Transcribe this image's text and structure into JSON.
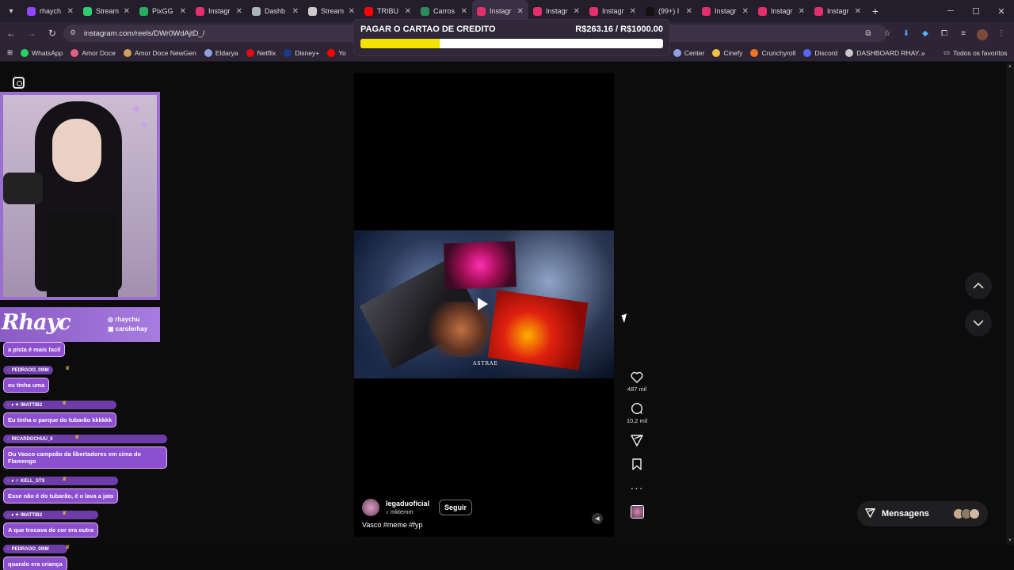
{
  "browser": {
    "tabs": [
      {
        "label": "rhaych",
        "icon": "twitch-icon",
        "color": "#9146ff"
      },
      {
        "label": "Stream",
        "icon": "streamelements-icon",
        "color": "#2ecc71"
      },
      {
        "label": "PixGG",
        "icon": "pixgg-icon",
        "color": "#27ae60"
      },
      {
        "label": "Instagr",
        "icon": "instagram-icon",
        "color": "#e1306c"
      },
      {
        "label": "Dashb",
        "icon": "dashboard-icon",
        "color": "#aab4c0"
      },
      {
        "label": "Stream",
        "icon": "stream-icon",
        "color": "#cccccc"
      },
      {
        "label": "TRIBU",
        "icon": "youtube-icon",
        "color": "#ff0000"
      },
      {
        "label": "Carros",
        "icon": "link-icon",
        "color": "#2e8b57"
      },
      {
        "label": "Instagr",
        "icon": "instagram-icon",
        "color": "#e1306c",
        "active": true
      },
      {
        "label": "Instagr",
        "icon": "instagram-icon",
        "color": "#e1306c"
      },
      {
        "label": "Instagr",
        "icon": "instagram-icon",
        "color": "#e1306c"
      },
      {
        "label": "(99+) I",
        "icon": "tiktok-icon",
        "color": "#111111"
      },
      {
        "label": "Instagr",
        "icon": "instagram-icon",
        "color": "#e1306c"
      },
      {
        "label": "Instagr",
        "icon": "instagram-icon",
        "color": "#e1306c"
      },
      {
        "label": "Instagr",
        "icon": "instagram-icon",
        "color": "#e1306c"
      }
    ],
    "url": "instagram.com/reels/DWr0WdAjtD_/",
    "bookmarks": [
      {
        "label": "WhatsApp",
        "color": "#25d366"
      },
      {
        "label": "Amor Doce",
        "color": "#e06080"
      },
      {
        "label": "Amor Doce NewGen",
        "color": "#d0a060"
      },
      {
        "label": "Eldarya",
        "color": "#8fa0e0"
      },
      {
        "label": "Netflix",
        "color": "#e50914"
      },
      {
        "label": "Disney+",
        "color": "#1a3a8a"
      },
      {
        "label": "Yo",
        "color": "#ff0000"
      },
      {
        "label": "Center",
        "color": "#8fa0e0"
      },
      {
        "label": "Cinefy",
        "color": "#f0c040"
      },
      {
        "label": "Crunchyroll",
        "color": "#f47521"
      },
      {
        "label": "Discord",
        "color": "#5865f2"
      },
      {
        "label": "DASHBOARD RHAY...",
        "color": "#c8c8c8"
      }
    ],
    "bookmarks_other": "Todos os favoritos"
  },
  "goal": {
    "title": "PAGAR O CARTAO DE CREDITO",
    "amount": "R$263.16 / R$1000.00",
    "progress_fraction": 0.263
  },
  "reel": {
    "art_text": "ASTRAE",
    "author": "legaduoficial",
    "audio": "mktemm",
    "follow_label": "Seguir",
    "caption": "Vasco #meme #fyp",
    "likes": "487 mil",
    "comments": "10,2 mil"
  },
  "messages_label": "Mensagens",
  "stream": {
    "banner_title": "Rhayc",
    "handles": [
      "rhaychu",
      "carolerhay"
    ],
    "chat": [
      {
        "user": "",
        "text": "a pista é mais facil"
      },
      {
        "user": "PEDRAOO_00IM",
        "text": "eu tinha uma"
      },
      {
        "user": "IMATTIB2",
        "text": "Eu tinha o parque do tubarão kkkkkk"
      },
      {
        "user": "RICARDOCHUU_II",
        "text": "Ou Vasco campeão da libertadores em cima do Flamengo"
      },
      {
        "user": "KELL_STS",
        "text": "Esse não é do tubarão, é o lava a jato"
      },
      {
        "user": "IMATTIB2",
        "text": "A que trocava de cor era outra"
      },
      {
        "user": "PEDRAOO_00IM",
        "text": "quando era criança"
      }
    ]
  }
}
